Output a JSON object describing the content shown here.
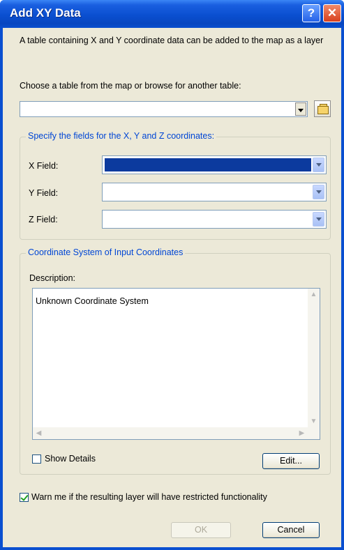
{
  "window": {
    "title": "Add XY Data",
    "help_glyph": "?",
    "close_glyph": "✕"
  },
  "intro_text": "A table containing X and Y coordinate data can be added to the map as a layer",
  "table_prompt": "Choose a table from the map or browse for another table:",
  "table_select": {
    "value": ""
  },
  "fields_group": {
    "title": "Specify the fields for the X, Y and Z coordinates:",
    "x_label": "X Field:",
    "y_label": "Y Field:",
    "z_label": "Z Field:"
  },
  "coordinate_group": {
    "title": "Coordinate System of Input Coordinates",
    "description_label": "Description:",
    "description_text": "Unknown Coordinate System",
    "show_details_label": "Show Details",
    "show_details_checked": false,
    "edit_button": "Edit..."
  },
  "warn_checkbox": {
    "label": "Warn me if the resulting layer will have restricted functionality",
    "checked": true
  },
  "buttons": {
    "ok": "OK",
    "cancel": "Cancel"
  },
  "colors": {
    "title_bar": "#0a4fd0",
    "dialog_bg": "#ece9d8",
    "group_title": "#0046d5",
    "selection": "#0c3a9e"
  }
}
